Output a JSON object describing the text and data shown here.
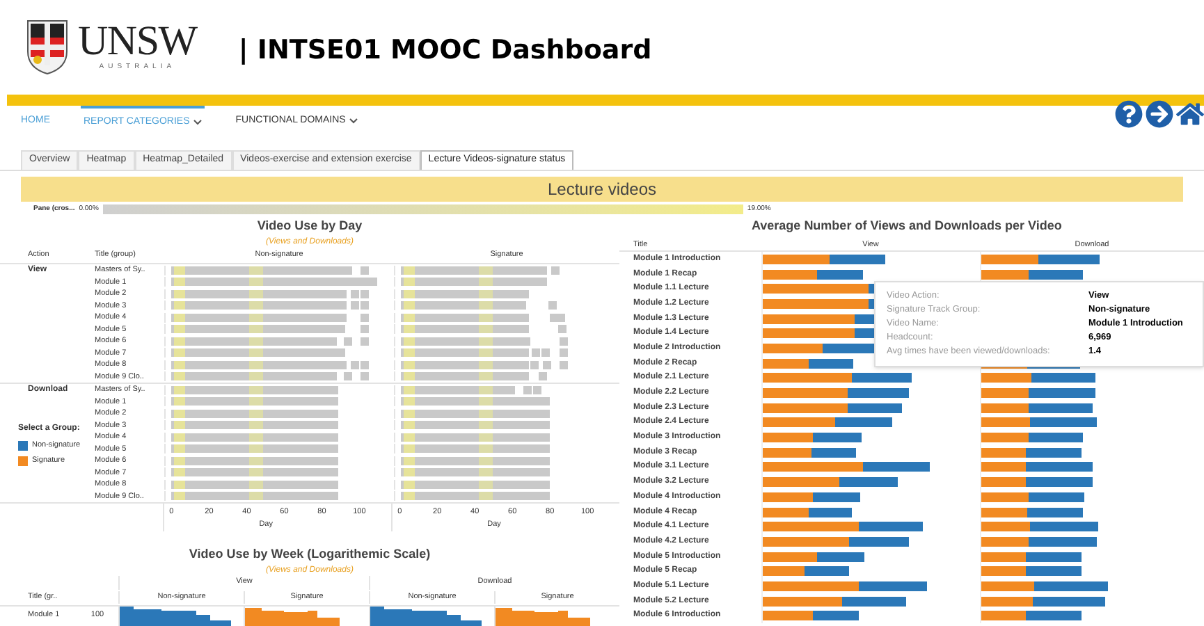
{
  "header": {
    "logo_text": "UNSW",
    "logo_subtext": "AUSTRALIA",
    "title": "| INTSE01 MOOC Dashboard"
  },
  "nav": [
    {
      "label": "HOME",
      "selected": false,
      "has_menu": false
    },
    {
      "label": "REPORT CATEGORIES",
      "selected": true,
      "has_menu": true
    },
    {
      "label": "FUNCTIONAL DOMAINS",
      "selected": false,
      "has_menu": true
    }
  ],
  "tabs": [
    {
      "label": "Overview",
      "selected": false
    },
    {
      "label": "Heatmap",
      "selected": false
    },
    {
      "label": "Heatmap_Detailed",
      "selected": false
    },
    {
      "label": "Videos-exercise and extension exercise",
      "selected": false
    },
    {
      "label": "Lecture Videos-signature status",
      "selected": true
    }
  ],
  "banner": "Lecture videos",
  "pane": {
    "label": "Pane (cros...",
    "min": "0.00%",
    "max": "19.00%"
  },
  "day_chart": {
    "title": "Video Use by Day",
    "subtitle": "(Views and Downloads)",
    "columns": [
      "Action",
      "Title (group)",
      "Non-signature",
      "Signature"
    ],
    "groups": [
      {
        "action": "View",
        "rows": [
          "Masters of Sy..",
          "Module 1",
          "Module 2",
          "Module 3",
          "Module 4",
          "Module 5",
          "Module 6",
          "Module 7",
          "Module 8",
          "Module 9 Clo.."
        ]
      },
      {
        "action": "Download",
        "rows": [
          "Masters of Sy..",
          "Module 1",
          "Module 2",
          "Module 3",
          "Module 4",
          "Module 5",
          "Module 6",
          "Module 7",
          "Module 8",
          "Module 9 Clo.."
        ]
      }
    ],
    "axes": [
      {
        "ticks": [
          "0",
          "20",
          "40",
          "60",
          "80",
          "100"
        ],
        "label": "Day"
      },
      {
        "ticks": [
          "0",
          "20",
          "40",
          "60",
          "80",
          "100"
        ],
        "label": "Day"
      }
    ]
  },
  "legend": {
    "title": "Select a Group:",
    "items": [
      {
        "label": "Non-signature",
        "color": "#2b78b8"
      },
      {
        "label": "Signature",
        "color": "#f28a22"
      }
    ]
  },
  "week_chart": {
    "title": "Video Use by Week (Logarithemic Scale)",
    "subtitle": "(Views and Downloads)",
    "actions": [
      {
        "label": "View",
        "groups": [
          "Non-signature",
          "Signature"
        ]
      },
      {
        "label": "Download",
        "groups": [
          "Non-signature",
          "Signature"
        ]
      }
    ],
    "title_header": "Title (gr..",
    "rows": [
      {
        "title": "Module 1",
        "tick": "100"
      }
    ]
  },
  "avg_chart": {
    "title": "Average Number of Views and Downloads per Video",
    "columns": [
      "Title",
      "View",
      "Download"
    ],
    "rows": [
      "Module 1 Introduction",
      "Module 1 Recap",
      "Module 1.1 Lecture",
      "Module 1.2 Lecture",
      "Module 1.3 Lecture",
      "Module 1.4 Lecture",
      "Module 2 Introduction",
      "Module 2 Recap",
      "Module 2.1 Lecture",
      "Module 2.2 Lecture",
      "Module 2.3 Lecture",
      "Module 2.4 Lecture",
      "Module 3 Introduction",
      "Module 3 Recap",
      "Module 3.1 Lecture",
      "Module 3.2 Lecture",
      "Module 4 Introduction",
      "Module 4 Recap",
      "Module 4.1 Lecture",
      "Module 4.2 Lecture",
      "Module 5 Introduction",
      "Module 5 Recap",
      "Module 5.1 Lecture",
      "Module 5.2 Lecture",
      "Module 6 Introduction"
    ]
  },
  "tooltip": [
    {
      "label": "Video Action:",
      "value": "View"
    },
    {
      "label": "Signature Track Group:",
      "value": "Non-signature"
    },
    {
      "label": "Video Name:",
      "value": "Module 1 Introduction"
    },
    {
      "label": "Headcount:",
      "value": "6,969"
    },
    {
      "label": "Avg times have been viewed/downloads:",
      "value": "1.4"
    }
  ]
}
